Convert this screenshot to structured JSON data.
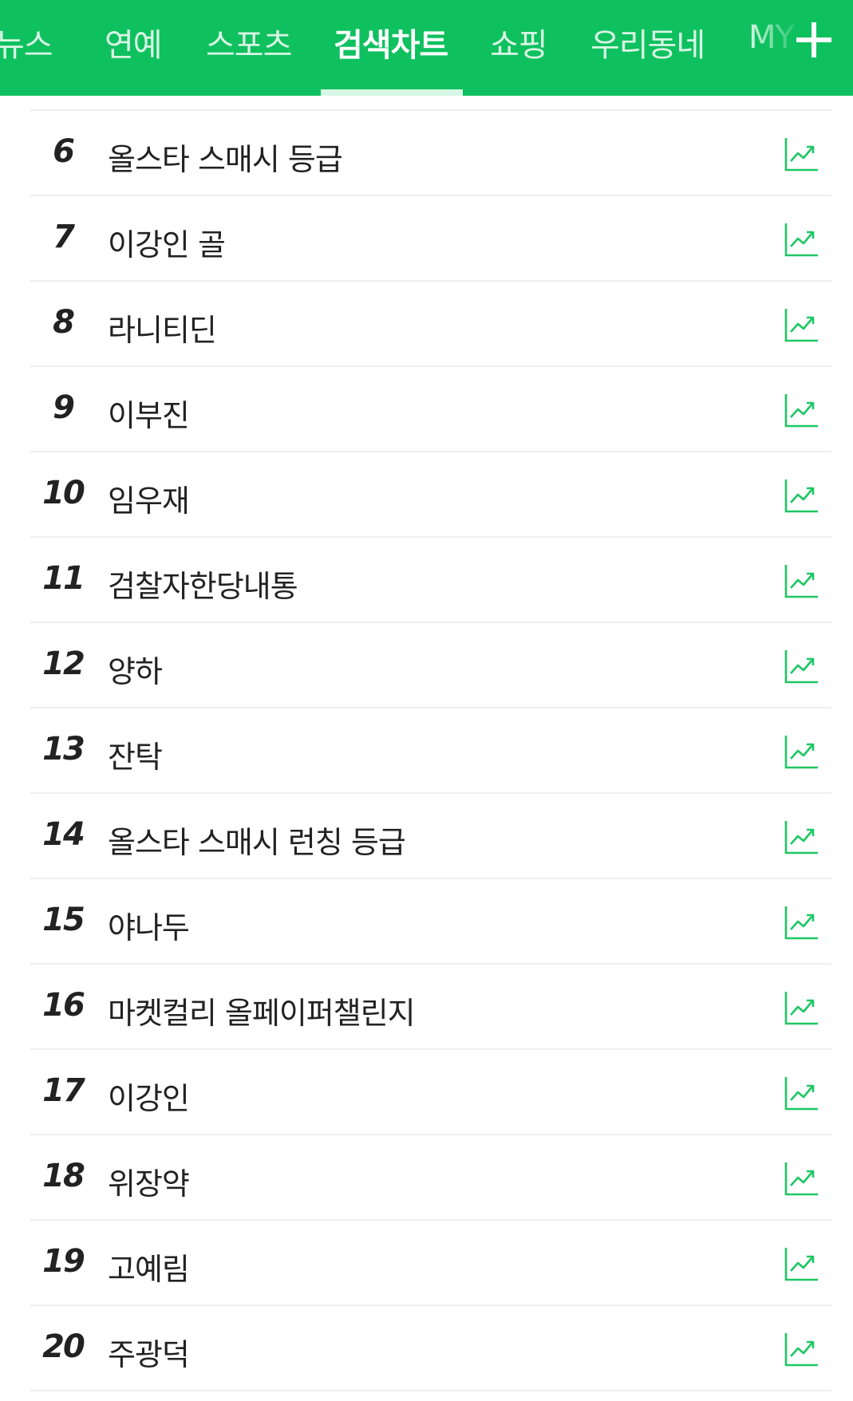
{
  "header": {
    "tabs": [
      {
        "label": "뉴스",
        "active": false
      },
      {
        "label": "연예",
        "active": false
      },
      {
        "label": "스포츠",
        "active": false
      },
      {
        "label": "검색차트",
        "active": true
      },
      {
        "label": "쇼핑",
        "active": false
      },
      {
        "label": "우리동네",
        "active": false
      },
      {
        "label": "MY",
        "active": false
      }
    ],
    "add_icon": "plus-icon",
    "accent_color": "#0fc05f"
  },
  "chart": {
    "items": [
      {
        "rank": "6",
        "keyword": "올스타 스매시 등급"
      },
      {
        "rank": "7",
        "keyword": "이강인 골"
      },
      {
        "rank": "8",
        "keyword": "라니티딘"
      },
      {
        "rank": "9",
        "keyword": "이부진"
      },
      {
        "rank": "10",
        "keyword": "임우재"
      },
      {
        "rank": "11",
        "keyword": "검찰자한당내통"
      },
      {
        "rank": "12",
        "keyword": "양하"
      },
      {
        "rank": "13",
        "keyword": "잔탁"
      },
      {
        "rank": "14",
        "keyword": "올스타 스매시 런칭 등급"
      },
      {
        "rank": "15",
        "keyword": "야나두"
      },
      {
        "rank": "16",
        "keyword": "마켓컬리 올페이퍼챌린지"
      },
      {
        "rank": "17",
        "keyword": "이강인"
      },
      {
        "rank": "18",
        "keyword": "위장약"
      },
      {
        "rank": "19",
        "keyword": "고예림"
      },
      {
        "rank": "20",
        "keyword": "주광덕"
      }
    ],
    "trend_icon": "trend-chart-icon",
    "trend_color": "#1ec763"
  }
}
